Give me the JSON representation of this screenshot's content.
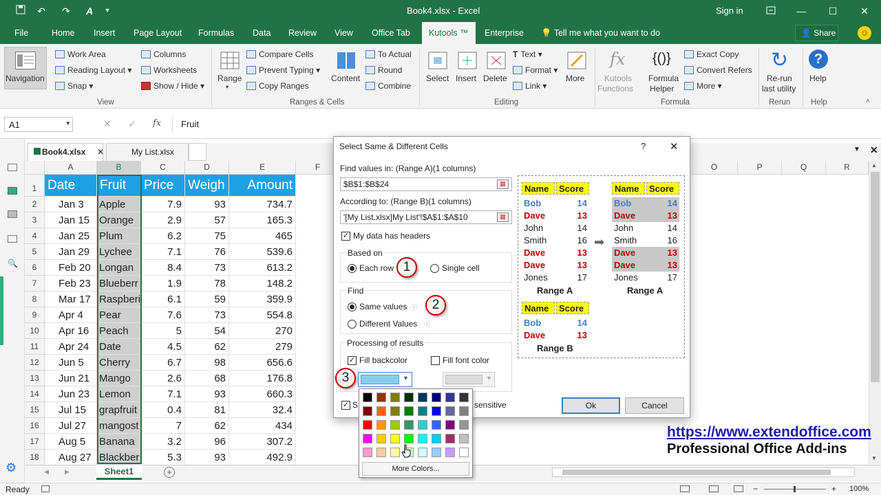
{
  "titlebar": {
    "title": "Book4.xlsx - Excel",
    "signin": "Sign in"
  },
  "ribbon_tabs": [
    "File",
    "Home",
    "Insert",
    "Page Layout",
    "Formulas",
    "Data",
    "Review",
    "View",
    "Office Tab",
    "Kutools ™",
    "Enterprise"
  ],
  "tell_me": "Tell me what you want to do",
  "share": "Share",
  "ribbon": {
    "navigation": "Navigation",
    "work_area": "Work Area",
    "reading_layout": "Reading Layout",
    "snap": "Snap",
    "columns": "Columns",
    "worksheets": "Worksheets",
    "show_hide": "Show / Hide",
    "group_view": "View",
    "range": "Range",
    "compare_cells": "Compare Cells",
    "prevent_typing": "Prevent Typing",
    "copy_ranges": "Copy Ranges",
    "to_actual": "To Actual",
    "round": "Round",
    "content": "Content",
    "combine": "Combine",
    "group_ranges": "Ranges & Cells",
    "select": "Select",
    "insert": "Insert",
    "delete": "Delete",
    "text": "Text",
    "format": "Format",
    "link": "Link",
    "more": "More",
    "group_editing": "Editing",
    "kutools_functions_1": "Kutools",
    "kutools_functions_2": "Functions",
    "formula_helper_1": "Formula",
    "formula_helper_2": "Helper",
    "exact_copy": "Exact Copy",
    "convert_refers": "Convert Refers",
    "more2": "More",
    "group_formula": "Formula",
    "rerun_1": "Re-run",
    "rerun_2": "last utility",
    "group_rerun": "Rerun",
    "help": "Help",
    "group_help": "Help"
  },
  "formula_bar": {
    "namebox": "A1",
    "fx": "fx",
    "value": "Fruit"
  },
  "doc_tabs": [
    "Book4.xlsx",
    "My List.xlsx"
  ],
  "columns": [
    "A",
    "B",
    "C",
    "D",
    "E",
    "F",
    "O",
    "P",
    "Q",
    "R"
  ],
  "rows": [
    "1",
    "2",
    "3",
    "4",
    "5",
    "6",
    "7",
    "8",
    "9",
    "10",
    "11",
    "12",
    "13",
    "14",
    "15",
    "16",
    "17",
    "18"
  ],
  "headers": [
    "Date",
    "Fruit",
    "Price",
    "Weigh",
    "Amount"
  ],
  "table": [
    [
      "Jan 3",
      "Apple",
      "7.9",
      "93",
      "734.7"
    ],
    [
      "Jan 15",
      "Orange",
      "2.9",
      "57",
      "165.3"
    ],
    [
      "Jan 25",
      "Plum",
      "6.2",
      "75",
      "465"
    ],
    [
      "Jan 29",
      "Lychee",
      "7.1",
      "76",
      "539.6"
    ],
    [
      "Feb 20",
      "Longan",
      "8.4",
      "73",
      "613.2"
    ],
    [
      "Feb 23",
      "Blueberr",
      "1.9",
      "78",
      "148.2"
    ],
    [
      "Mar 17",
      "Raspberi",
      "6.1",
      "59",
      "359.9"
    ],
    [
      "Apr 4",
      "Pear",
      "7.6",
      "73",
      "554.8"
    ],
    [
      "Apr 16",
      "Peach",
      "5",
      "54",
      "270"
    ],
    [
      "Apr 24",
      "Date",
      "4.5",
      "62",
      "279"
    ],
    [
      "Jun 5",
      "Cherry",
      "6.7",
      "98",
      "656.6"
    ],
    [
      "Jun 21",
      "Mango",
      "2.6",
      "68",
      "176.8"
    ],
    [
      "Jun 23",
      "Lemon",
      "7.1",
      "93",
      "660.3"
    ],
    [
      "Jul 15",
      "grapfruit",
      "0.4",
      "81",
      "32.4"
    ],
    [
      "Jul 27",
      "mangost",
      "7",
      "62",
      "434"
    ],
    [
      "Aug 5",
      "Banana",
      "3.2",
      "96",
      "307.2"
    ],
    [
      "Aug 27",
      "Blackber",
      "5.3",
      "93",
      "492.9"
    ]
  ],
  "dialog": {
    "title": "Select Same & Different Cells",
    "help": "?",
    "close": "✕",
    "find_in_label": "Find values in: (Range A)(1 columns)",
    "find_in_value": "$B$1:$B$24",
    "according_label": "According to: (Range B)(1 columns)",
    "according_value": "'[My List.xlsx]My List'!$A$1:$A$10",
    "headers_label": "My data has headers",
    "based_on": "Based on",
    "each_row": "Each row",
    "single_cell": "Single cell",
    "find": "Find",
    "same_values": "Same values",
    "different_values": "Different Values",
    "processing": "Processing of results",
    "fill_backcolor": "Fill backcolor",
    "fill_font_color": "Fill font color",
    "select_entire_partial": "S",
    "case_sensitive_partial": "sensitive",
    "ok": "Ok",
    "cancel": "Cancel",
    "badges": [
      "1",
      "2",
      "3"
    ],
    "preview": {
      "col_name": "Name",
      "col_score": "Score",
      "range_a": "Range A",
      "range_b": "Range B",
      "rows_a": [
        [
          "Bob",
          "14"
        ],
        [
          "Dave",
          "13"
        ],
        [
          "John",
          "14"
        ],
        [
          "Smith",
          "16"
        ],
        [
          "Dave",
          "13"
        ],
        [
          "Dave",
          "13"
        ],
        [
          "Jones",
          "17"
        ]
      ],
      "rows_b": [
        [
          "Bob",
          "14"
        ],
        [
          "Dave",
          "13"
        ]
      ]
    }
  },
  "palette": {
    "more_colors": "More Colors...",
    "colors": [
      [
        "#000000",
        "#993300",
        "#808000",
        "#003300",
        "#003366",
        "#000080",
        "#333399",
        "#333333"
      ],
      [
        "#800000",
        "#ff6600",
        "#808000",
        "#008000",
        "#008080",
        "#0000ff",
        "#666699",
        "#808080"
      ],
      [
        "#ff0000",
        "#ff9900",
        "#99cc00",
        "#339966",
        "#33cccc",
        "#3366ff",
        "#800080",
        "#969696"
      ],
      [
        "#ff00ff",
        "#ffcc00",
        "#ffff00",
        "#00ff00",
        "#00ffff",
        "#00ccff",
        "#993366",
        "#c0c0c0"
      ],
      [
        "#ff99cc",
        "#ffcc99",
        "#ffff99",
        "#ccffcc",
        "#ccffff",
        "#99ccff",
        "#cc99ff",
        "#ffffff"
      ]
    ]
  },
  "sheet_tab": "Sheet1",
  "status": "Ready",
  "zoom": "100%",
  "watermark": {
    "url": "https://www.extendoffice.com",
    "tagline": "Professional Office Add-ins"
  },
  "colors": {
    "excel_green": "#217346",
    "header_blue": "#1ea0e6",
    "preview_yellow": "#ffff00"
  }
}
